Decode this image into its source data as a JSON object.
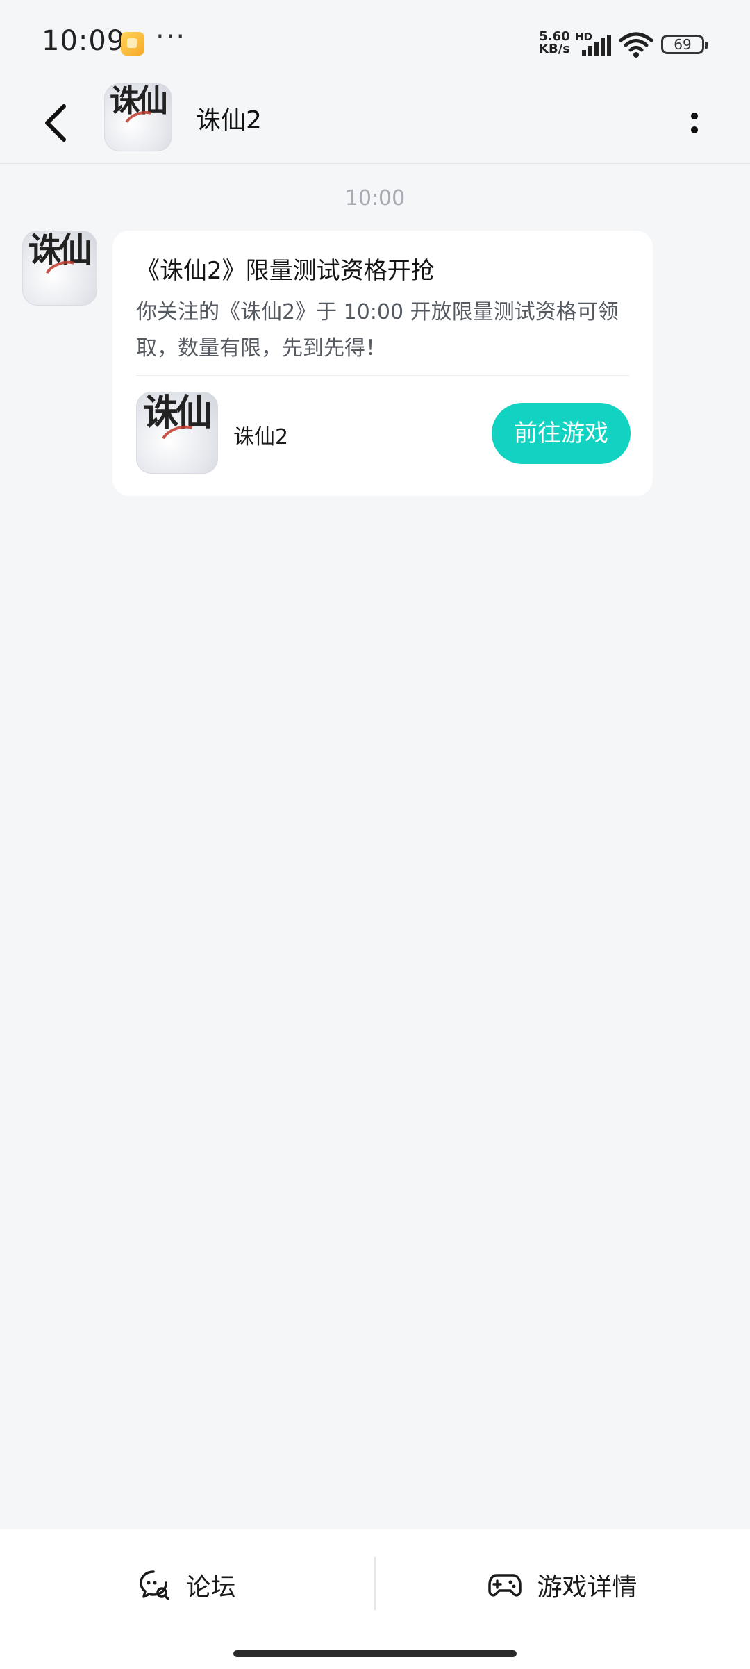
{
  "status_bar": {
    "time": "10:09",
    "more": "···",
    "net_speed_value": "5.60",
    "net_speed_unit": "KB/s",
    "hd": "HD",
    "battery": "69"
  },
  "header": {
    "title": "诛仙2",
    "icon_text": "诛仙"
  },
  "chat": {
    "timestamp": "10:00",
    "avatar_text": "诛仙",
    "card": {
      "title": "《诛仙2》限量测试资格开抢",
      "description": "你关注的《诛仙2》于 10:00 开放限量测试资格可领取，数量有限，先到先得！",
      "game_icon_text": "诛仙",
      "game_name": "诛仙2",
      "button_label": "前往游戏",
      "button_color": "#12d3c2"
    }
  },
  "bottom_bar": {
    "forum_label": "论坛",
    "details_label": "游戏详情"
  }
}
